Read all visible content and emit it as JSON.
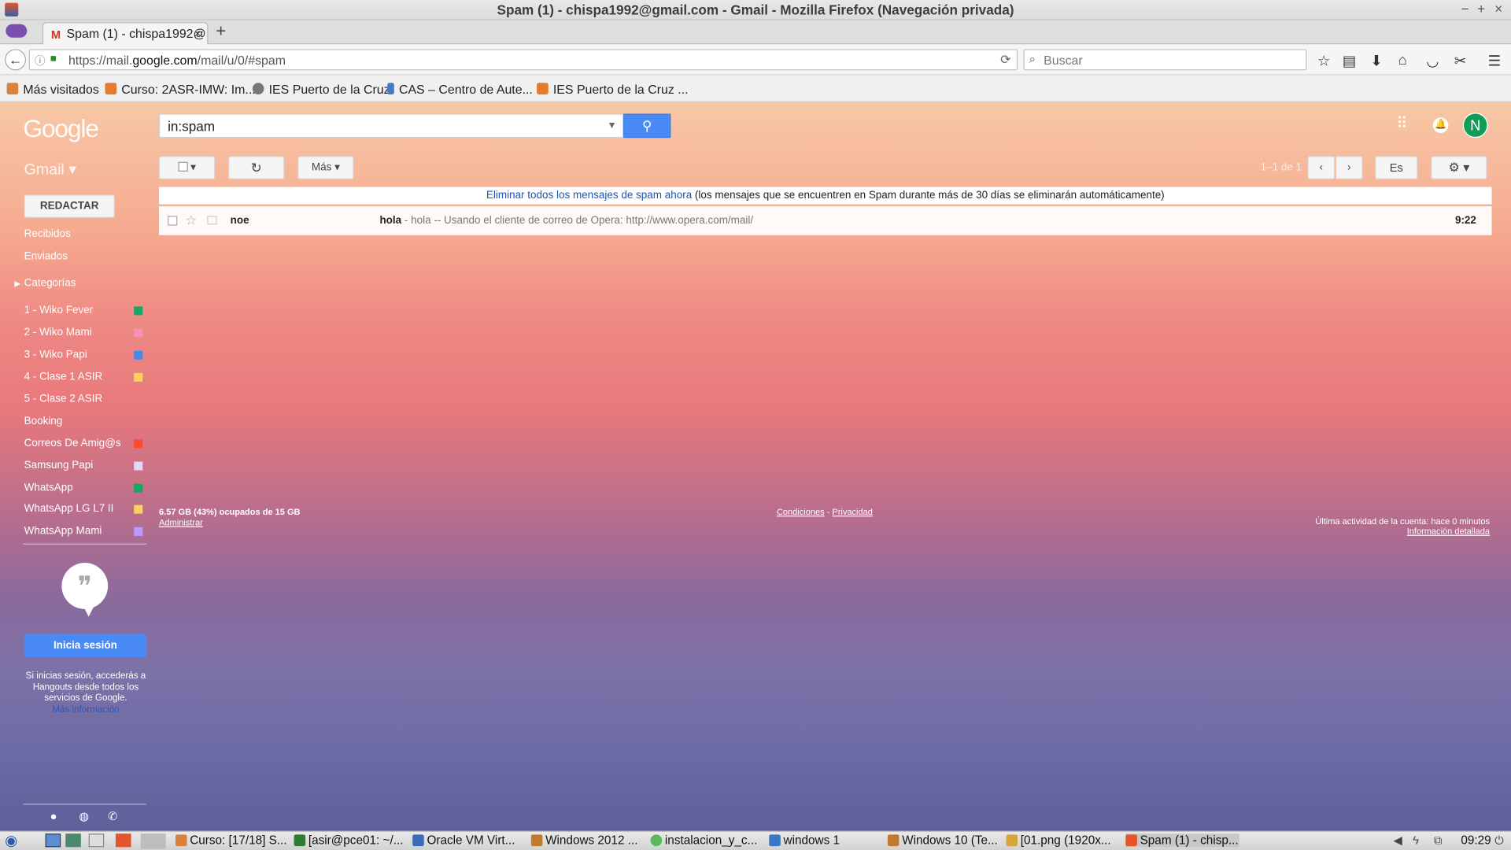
{
  "window": {
    "title": "Spam (1) - chispa1992@gmail.com - Gmail - Mozilla Firefox (Navegación privada)",
    "controls": [
      "−",
      "+",
      "×"
    ]
  },
  "tab": {
    "label": "Spam (1) - chispa1992@",
    "close": "×",
    "favicon": "M",
    "new_tab": "+"
  },
  "navbar": {
    "back": "←",
    "url_prefix": "https://mail.",
    "url_host": "google.com",
    "url_path": "/mail/u/0/#spam",
    "reload": "⟳",
    "search_placeholder": "Buscar",
    "icons": [
      "star-icon",
      "bookmarks-list-icon",
      "download-icon",
      "home-icon",
      "pocket-icon",
      "screenshot-icon",
      "menu-icon"
    ]
  },
  "bookmarks": [
    {
      "label": "Más visitados",
      "color": "#d9823b"
    },
    {
      "label": "Curso: 2ASR-IMW: Im...",
      "color": "#e57b2c"
    },
    {
      "label": "IES Puerto de la Cruz",
      "color": "#777777"
    },
    {
      "label": "CAS – Centro de Aute...",
      "color": "#4a78c4"
    },
    {
      "label": "IES Puerto de la Cruz ...",
      "color": "#e57b2c"
    }
  ],
  "gmail": {
    "logo": "Google",
    "search_value": "in:spam",
    "avatar_letter": "N",
    "app_label": "Gmail ▾",
    "toolbar": {
      "select": "▾",
      "refresh": "↻",
      "more": "Más ▾",
      "lang": "Es",
      "settings": "⚙ ▾"
    },
    "page_count": "1–1 de 1",
    "compose": "REDACTAR",
    "nav": [
      {
        "label": "Recibidos"
      },
      {
        "label": "Enviados"
      },
      {
        "label": "Categorías"
      }
    ],
    "labels": [
      {
        "label": "1 - Wiko Fever",
        "color": "#16a765"
      },
      {
        "label": "2 - Wiko Mami",
        "color": "#f691b2"
      },
      {
        "label": "3 - Wiko Papi",
        "color": "#4986e7"
      },
      {
        "label": "4 - Clase 1 ASIR",
        "color": "#fad165"
      },
      {
        "label": "5 - Clase 2 ASIR",
        "color": ""
      },
      {
        "label": "Booking",
        "color": ""
      },
      {
        "label": "Correos De Amig@s",
        "color": "#fb4c2f"
      },
      {
        "label": "Samsung Papi",
        "color": "#e3d7ff"
      },
      {
        "label": "WhatsApp",
        "color": "#16a765"
      },
      {
        "label": "WhatsApp LG L7 II",
        "color": "#fad165"
      },
      {
        "label": "WhatsApp Mami",
        "color": "#b99aff"
      }
    ],
    "hangouts": {
      "signin": "Inicia sesión",
      "info": "Si inicias sesión, accederás a Hangouts desde todos los servicios de Google.",
      "more_link": "Más información"
    },
    "banner": {
      "link": "Eliminar todos los mensajes de spam ahora",
      "text": " (los mensajes que se encuentren en Spam durante más de 30 días se eliminarán automáticamente)"
    },
    "messages": [
      {
        "sender": "noe",
        "subject": "hola",
        "snippet": " - hola -- Usando el cliente de correo de Opera: http://www.opera.com/mail/",
        "time": "9:22"
      }
    ],
    "footer": {
      "storage": "6.57 GB (43%) ocupados de 15 GB",
      "manage": "Administrar",
      "terms": "Condiciones",
      "sep": " - ",
      "privacy": "Privacidad",
      "activity": "Última actividad de la cuenta: hace 0 minutos",
      "details": "Información detallada"
    }
  },
  "taskbar": {
    "items": [
      {
        "label": "Curso: [17/18] S...",
        "color": "#d9823b"
      },
      {
        "label": "[asir@pce01: ~/...",
        "color": "#2e7d32"
      },
      {
        "label": "Oracle VM Virt...",
        "color": "#3b6cb4"
      },
      {
        "label": "Windows 2012 ...",
        "color": "#c07a30"
      },
      {
        "label": "instalacion_y_c...",
        "color": "#5cb85c"
      },
      {
        "label": "windows 1",
        "color": "#3b78c4"
      },
      {
        "label": "Windows 10 (Te...",
        "color": "#c07a30"
      },
      {
        "label": "[01.png (1920x...",
        "color": "#d4a73b"
      },
      {
        "label": "Spam (1) - chisp...",
        "color": "#e4552a"
      }
    ],
    "clock": "09:29"
  }
}
